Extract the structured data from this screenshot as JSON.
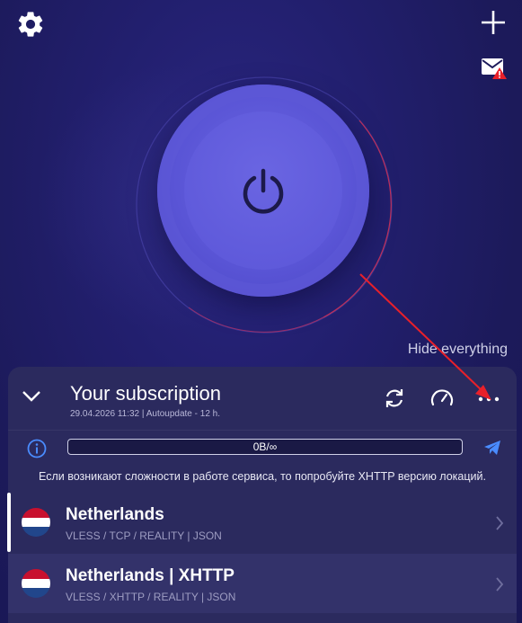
{
  "icons": {
    "settings": "gear-icon",
    "add": "plus-icon",
    "mail": "mail-alert-icon",
    "power": "power-icon",
    "collapse": "chevron-down-icon",
    "refresh": "refresh-icon",
    "speed": "speedometer-icon",
    "more": "more-dots-icon",
    "info": "info-icon",
    "telegram": "telegram-icon",
    "row_arrow": "chevron-right-icon"
  },
  "main": {
    "hide_label": "Hide everything"
  },
  "subscription": {
    "title": "Your subscription",
    "meta": "29.04.2026 11:32 | Autoupdate - 12 h.",
    "traffic": "0B/∞",
    "notice": "Если возникают сложности в работе сервиса, то попробуйте XHTTP версию локаций."
  },
  "servers": [
    {
      "name": "Netherlands",
      "protocol": "VLESS / TCP / REALITY | JSON",
      "active": true
    },
    {
      "name": "Netherlands | XHTTP",
      "protocol": "VLESS / XHTTP / REALITY | JSON",
      "active": false
    }
  ],
  "colors": {
    "background": "#1c1a5a",
    "panel": "#2b2a5e",
    "power_button": "#5a55d6",
    "accent_blue": "#4a8cff",
    "annotation_arrow": "#e8202a",
    "flag_red": "#c8102e",
    "flag_blue": "#21468b"
  }
}
